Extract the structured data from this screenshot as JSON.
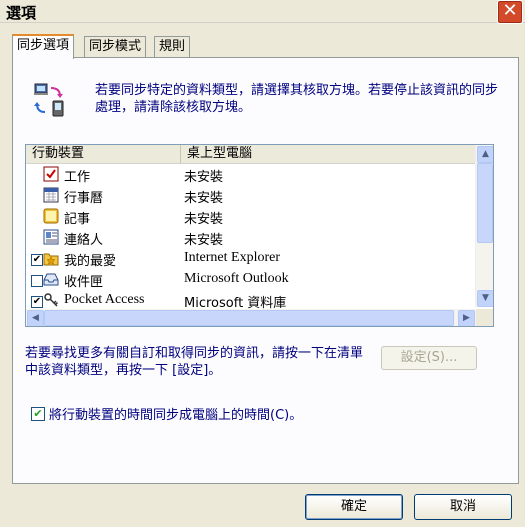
{
  "window": {
    "title": "選項"
  },
  "tabs": [
    {
      "label": "同步選項"
    },
    {
      "label": "同步模式"
    },
    {
      "label": "規則"
    }
  ],
  "description": "若要同步特定的資料類型，請選擇其核取方塊。若要停止該資訊的同步處理，請清除該核取方塊。",
  "list": {
    "headers": {
      "device": "行動裝置",
      "desktop": "桌上型電腦"
    },
    "rows": [
      {
        "name": "工作",
        "status": "未安裝",
        "icon": "task-icon"
      },
      {
        "name": "行事曆",
        "status": "未安裝",
        "icon": "calendar-icon"
      },
      {
        "name": "記事",
        "status": "未安裝",
        "icon": "notes-icon"
      },
      {
        "name": "連絡人",
        "status": "未安裝",
        "icon": "contacts-icon"
      },
      {
        "name": "我的最愛",
        "status": "Internet Explorer",
        "icon": "favorites-folder-icon",
        "checked": true
      },
      {
        "name": "收件匣",
        "status": "Microsoft Outlook",
        "icon": "inbox-icon",
        "checked": false
      },
      {
        "name": "Pocket Access",
        "status": "Microsoft 資料庫",
        "icon": "pocket-access-icon",
        "checked": true
      }
    ]
  },
  "info_text": "若要尋找更多有關自訂和取得同步的資訊，請按一下在清單中該資料類型，再按一下 [設定]。",
  "settings_button": "設定(S)...",
  "time_sync": {
    "label": "將行動裝置的時間同步成電腦上的時間(C)。",
    "checked": true
  },
  "buttons": {
    "ok": "確定",
    "cancel": "取消"
  }
}
